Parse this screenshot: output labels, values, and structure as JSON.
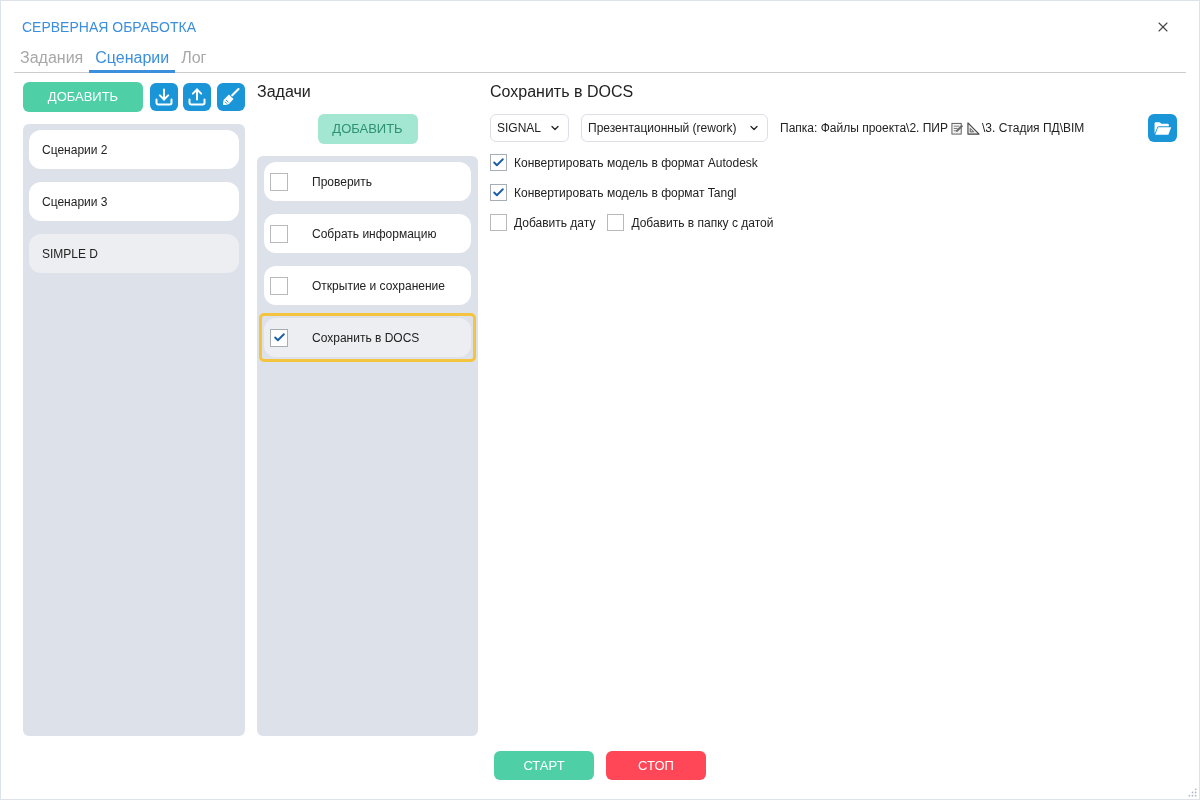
{
  "window": {
    "title": "СЕРВЕРНАЯ ОБРАБОТКА"
  },
  "tabs": [
    {
      "label": "Задания",
      "selected": false
    },
    {
      "label": "Сценарии",
      "selected": true
    },
    {
      "label": "Лог",
      "selected": false
    }
  ],
  "scenarios": {
    "add_button": {
      "label": "ДОБАВИТЬ"
    },
    "items": [
      {
        "label": "Сценарии 2",
        "selected": false
      },
      {
        "label": "Сценарии 3",
        "selected": false
      },
      {
        "label": "SIMPLE D",
        "selected": true
      }
    ]
  },
  "tasks": {
    "heading": "Задачи",
    "add_button": {
      "label": "ДОБАВИТЬ",
      "disabled": true
    },
    "items": [
      {
        "label": "Проверить",
        "checked": false,
        "selected": false
      },
      {
        "label": "Собрать информацию",
        "checked": false,
        "selected": false
      },
      {
        "label": "Открытие и сохранение",
        "checked": false,
        "selected": false
      },
      {
        "label": "Сохранить в DOCS",
        "checked": true,
        "selected": true
      }
    ]
  },
  "task_settings": {
    "heading": "Сохранить в DOCS",
    "selects": [
      {
        "value": "SIGNAL"
      },
      {
        "value": "Презентационный (rework)"
      }
    ],
    "folder_path_start": "Папка: Файлы проекта\\2. ПИР",
    "folder_path_end": "\\3. Стадия ПД\\BIM",
    "option_rows": [
      {
        "options": [
          {
            "label": "Конвертировать модель в формат Autodesk",
            "checked": true
          }
        ]
      },
      {
        "options": [
          {
            "label": "Конвертировать модель в формат Tangl",
            "checked": true
          }
        ]
      },
      {
        "options": [
          {
            "label": "Добавить дату",
            "checked": false
          },
          {
            "label": "Добавить в папку с датой",
            "checked": false
          }
        ]
      }
    ]
  },
  "footer": {
    "buttons": [
      {
        "label": "СТАРТ",
        "kind": "start"
      },
      {
        "label": "СТОП",
        "kind": "stop"
      }
    ]
  }
}
